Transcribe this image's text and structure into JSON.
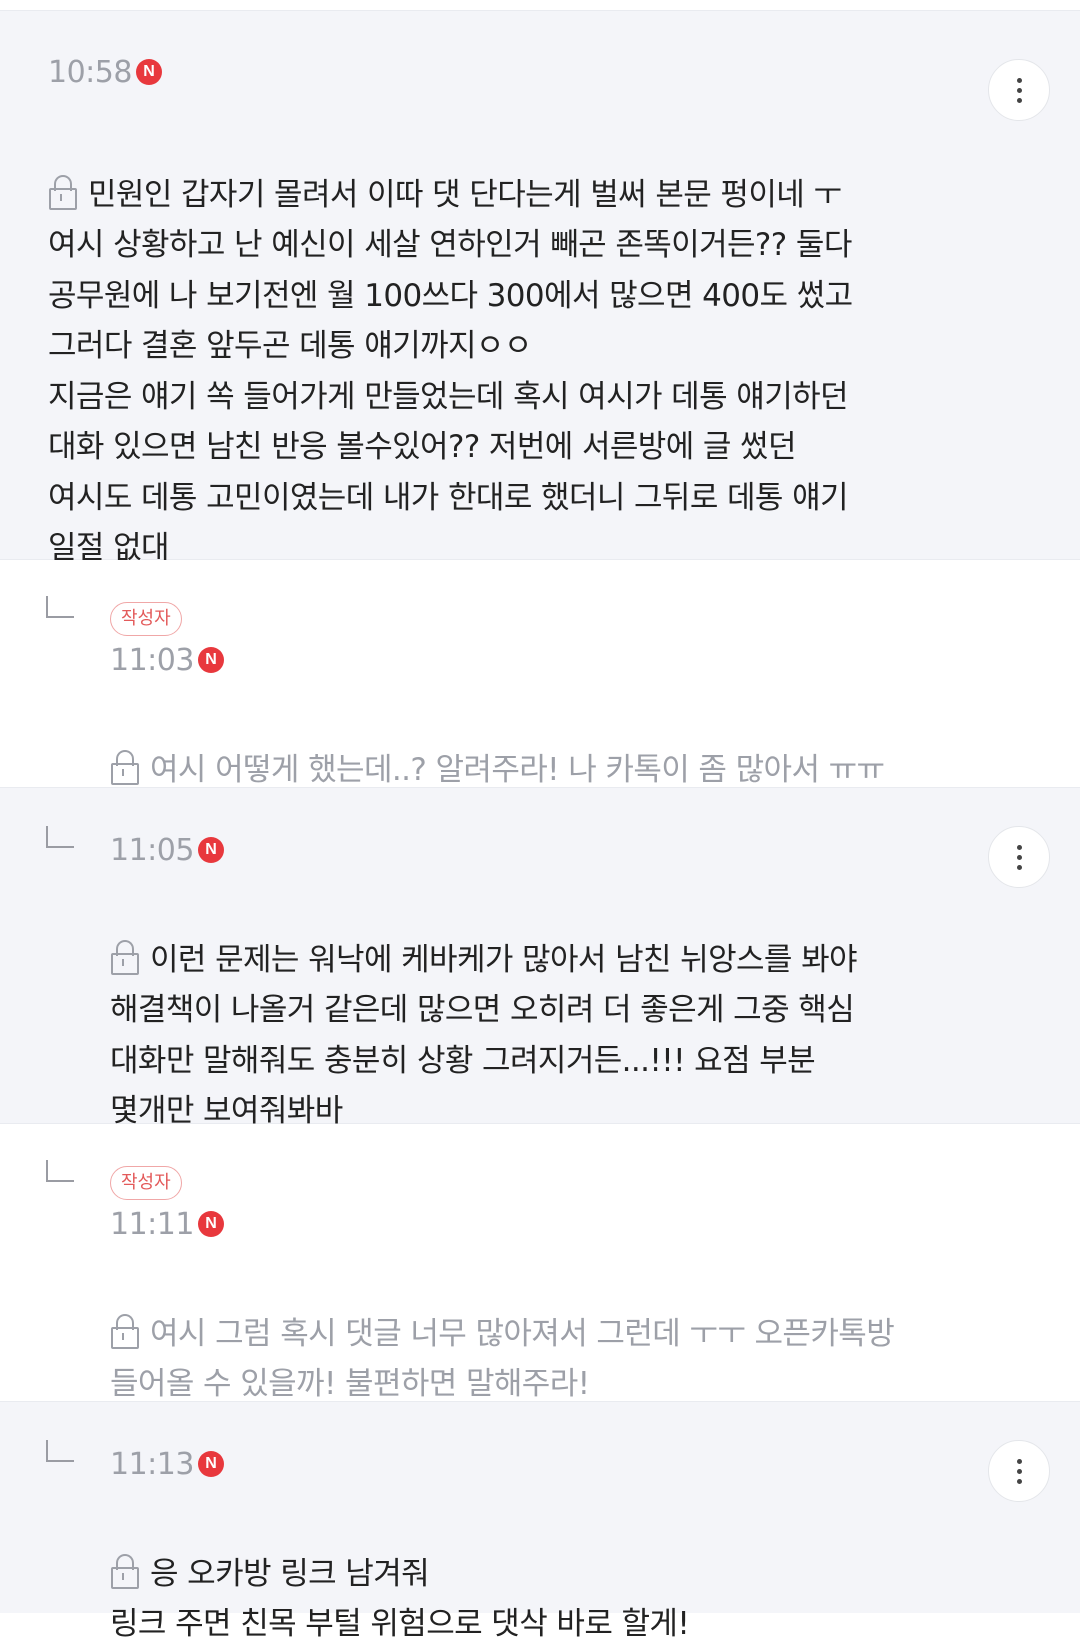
{
  "comments": [
    {
      "time": "10:58",
      "new_badge": "N",
      "text": "민원인 갑자기 몰려서 이따 댓 단다는게 벌써 본문 펑이네 ㅜ\n여시 상황하고 난 예신이 세살 연하인거 빼곤 존똑이거든?? 둘다\n공무원에 나 보기전엔 월 100쓰다 300에서 많으면 400도 썼고\n그러다 결혼 앞두곤 데통 얘기까지ㅇㅇ\n지금은 얘기 쏙 들어가게 만들었는데 혹시 여시가 데통 얘기하던\n대화 있으면 남친 반응 볼수있어?? 저번에 서른방에 글 썼던\n여시도 데통 고민이였는데 내가 한대로 했더니 그뒤로 데통 얘기\n일절 없대"
    },
    {
      "author_badge": "작성자",
      "time": "11:03",
      "new_badge": "N",
      "text": "여시 어떻게 했는데..? 알려주라! 나 카톡이 좀 많아서 ㅠㅠ"
    },
    {
      "time": "11:05",
      "new_badge": "N",
      "text": "이런 문제는 워낙에 케바케가 많아서 남친 뉘앙스를 봐야\n해결책이 나올거 같은데 많으면 오히려 더 좋은게 그중 핵심\n대화만 말해줘도 충분히 상황 그려지거든...!!! 요점 부분\n몇개만 보여줘봐바"
    },
    {
      "author_badge": "작성자",
      "time": "11:11",
      "new_badge": "N",
      "text": "여시 그럼 혹시 댓글 너무 많아져서 그런데 ㅜㅜ 오픈카톡방\n들어올 수 있을까! 불편하면 말해주라!"
    },
    {
      "time": "11:13",
      "new_badge": "N",
      "text": "응 오카방 링크 남겨줘\n링크 주면 친목 부털 위험으로 댓삭 바로 할게!"
    }
  ]
}
